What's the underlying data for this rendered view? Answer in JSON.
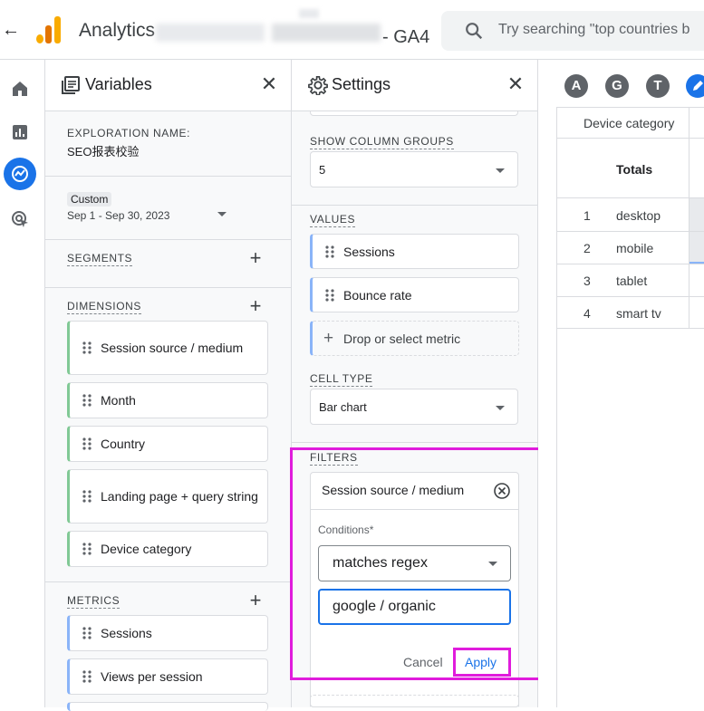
{
  "topbar": {
    "back_glyph": "←",
    "app_name": "Analytics",
    "property_suffix": "- GA4",
    "search_placeholder": "Try searching \"top countries b"
  },
  "rail": {
    "icons": [
      "home-icon",
      "reports-icon",
      "explore-icon",
      "advertising-icon"
    ],
    "active_icon": "explore-icon"
  },
  "variables": {
    "title": "Variables",
    "close_glyph": "✕",
    "exploration_name_label": "EXPLORATION NAME:",
    "exploration_name": "SEO报表校验",
    "date_badge": "Custom",
    "date_range": "Sep 1 - Sep 30, 2023",
    "segments_label": "SEGMENTS",
    "dimensions_label": "DIMENSIONS",
    "dimensions": [
      "Session source / medium",
      "Month",
      "Country",
      "Landing page + query string",
      "Device category"
    ],
    "metrics_label": "METRICS",
    "metrics": [
      "Sessions",
      "Views per session"
    ],
    "plus_glyph": "+"
  },
  "settings": {
    "title": "Settings",
    "close_glyph": "✕",
    "show_column_groups_label": "SHOW COLUMN GROUPS",
    "show_column_groups_value": "5",
    "values_label": "VALUES",
    "values": [
      "Sessions",
      "Bounce rate"
    ],
    "drop_metric_label": "Drop or select metric",
    "cell_type_label": "CELL TYPE",
    "cell_type_value": "Bar chart",
    "filters_label": "FILTERS",
    "filter": {
      "dimension": "Session source / medium",
      "conditions_label": "Conditions*",
      "match_type": "matches regex",
      "expression": "google / organic",
      "cancel_label": "Cancel",
      "apply_label": "Apply"
    }
  },
  "report": {
    "tabs": [
      "A",
      "G",
      "T"
    ],
    "column_header": "Device category",
    "totals_label": "Totals",
    "rows": [
      {
        "index": "1",
        "label": "desktop"
      },
      {
        "index": "2",
        "label": "mobile"
      },
      {
        "index": "3",
        "label": "tablet"
      },
      {
        "index": "4",
        "label": "smart tv"
      }
    ]
  },
  "colors": {
    "accent": "#1a73e8",
    "highlight": "#e01cdc",
    "dimension_bar": "#81c995",
    "metric_bar": "#8ab4f8"
  }
}
